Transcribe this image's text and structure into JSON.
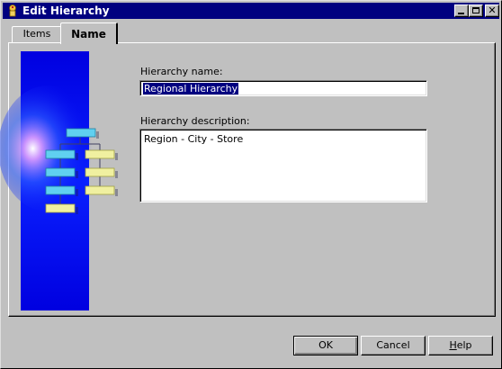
{
  "window": {
    "title": "Edit Hierarchy",
    "title_icon": "app-icon",
    "controls": [
      "minimize-icon",
      "maximize-icon",
      "close-icon"
    ]
  },
  "tabs": [
    {
      "label": "Items",
      "active": false
    },
    {
      "label": "Name",
      "active": true
    }
  ],
  "illustration": {
    "icon": "hierarchy-illustration",
    "background_color": "#0000f0"
  },
  "form": {
    "name_label": "Hierarchy name:",
    "name_value": "Regional Hierarchy",
    "description_label": "Hierarchy description:",
    "description_value": "Region - City - Store"
  },
  "buttons": {
    "ok": "OK",
    "cancel": "Cancel",
    "help_first": "H",
    "help_rest": "elp"
  },
  "colors": {
    "titlebar": "#000080",
    "face": "#c0c0c0",
    "selection": "#000080"
  }
}
